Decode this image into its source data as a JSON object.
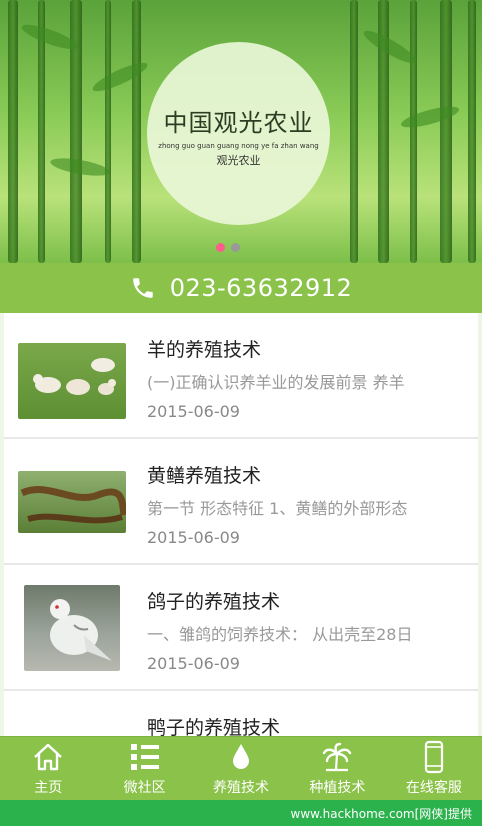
{
  "banner": {
    "title": "中国观光农业",
    "pinyin": "zhong guo guan guang nong ye fa zhan wang",
    "subtitle": "观光农业",
    "slide_count": 2,
    "active_slide": 1
  },
  "contact": {
    "phone": "023-63632912"
  },
  "articles": [
    {
      "title": "羊的养殖技术",
      "desc": "(一)正确认识养羊业的发展前景 养羊",
      "date": "2015-06-09",
      "image": "sheep"
    },
    {
      "title": "黄鳝养殖技术",
      "desc": "第一节 形态特征 1、黄鳝的外部形态",
      "date": "2015-06-09",
      "image": "eel"
    },
    {
      "title": "鸽子的养殖技术",
      "desc": "一、雏鸽的饲养技术： 从出壳至28日",
      "date": "2015-06-09",
      "image": "pigeon"
    },
    {
      "title": "鸭子的养殖技术",
      "desc": "",
      "date": "",
      "image": "duck"
    }
  ],
  "nav": [
    {
      "label": "主页",
      "icon": "home-icon"
    },
    {
      "label": "微社区",
      "icon": "list-icon"
    },
    {
      "label": "养殖技术",
      "icon": "drop-icon"
    },
    {
      "label": "种植技术",
      "icon": "palm-tree-icon"
    },
    {
      "label": "在线客服",
      "icon": "mobile-phone-icon"
    }
  ],
  "watermark": "www.hackhome.com[网侠]提供",
  "colors": {
    "primary": "#8bc34a",
    "watermark_bar": "#2bb24c",
    "active_dot": "#ff5c8d"
  }
}
